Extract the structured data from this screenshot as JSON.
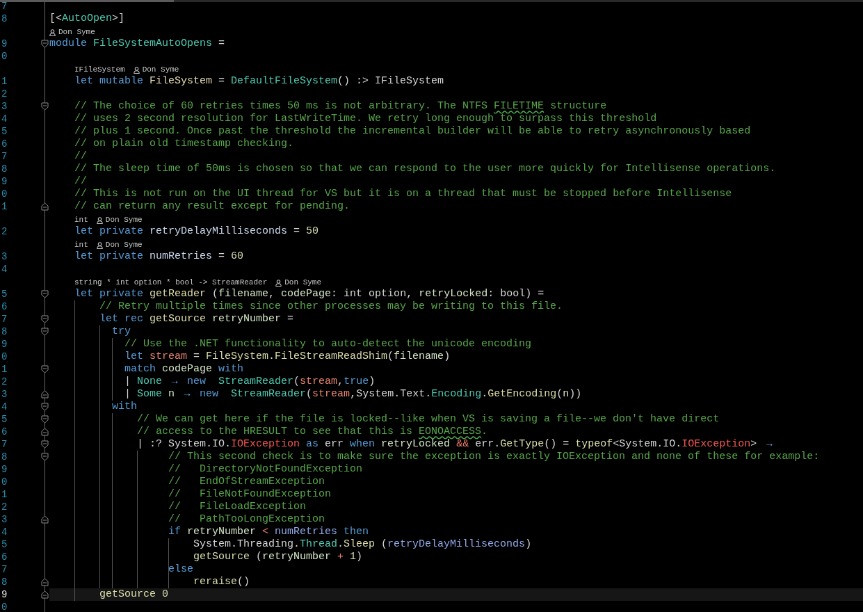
{
  "editor": {
    "rows": [
      {
        "kind": "code",
        "number": "7",
        "fold_start": false,
        "fold_end": false,
        "current": false
      },
      {
        "kind": "code",
        "number": "8",
        "fold_start": false,
        "fold_end": false,
        "current": false,
        "tokens": [
          {
            "kind": "p",
            "text": "[<"
          },
          {
            "kind": "type",
            "text": "AutoOpen"
          },
          {
            "kind": "p",
            "text": ">]"
          }
        ]
      },
      {
        "kind": "lens",
        "items": [
          {
            "kind": "author",
            "text": "Don Syme"
          }
        ]
      },
      {
        "kind": "code",
        "number": "9",
        "fold_start": true,
        "fold_end": false,
        "current": false,
        "tokens": [
          {
            "kind": "kw",
            "text": "module "
          },
          {
            "kind": "type",
            "text": "FileSystemAutoOpens"
          },
          {
            "kind": "p",
            "text": " ="
          }
        ]
      },
      {
        "kind": "code",
        "number": "0",
        "fold_start": false,
        "fold_end": false,
        "current": false
      },
      {
        "kind": "lens",
        "items": [
          {
            "kind": "type",
            "text": "IFileSystem"
          },
          {
            "kind": "author",
            "text": "Don Syme"
          }
        ]
      },
      {
        "kind": "code",
        "number": "1",
        "fold_start": false,
        "fold_end": false,
        "current": false,
        "tokens": [
          {
            "kind": "kw",
            "text": "    let mutable "
          },
          {
            "kind": "var",
            "text": "FileSystem"
          },
          {
            "kind": "p",
            "text": " = "
          },
          {
            "kind": "type",
            "text": "DefaultFileSystem"
          },
          {
            "kind": "p",
            "text": "() :> IFileSystem"
          }
        ]
      },
      {
        "kind": "code",
        "number": "2",
        "fold_start": false,
        "fold_end": false,
        "current": false
      },
      {
        "kind": "code",
        "number": "3",
        "fold_start": true,
        "fold_end": false,
        "current": false,
        "tokens": [
          {
            "kind": "c",
            "text": "    // The choice of 60 retries times 50 ms is not arbitrary. The NTFS "
          },
          {
            "kind": "spell",
            "text": "FILETIME"
          },
          {
            "kind": "c",
            "text": " structure"
          }
        ]
      },
      {
        "kind": "code",
        "number": "4",
        "fold_start": false,
        "fold_end": false,
        "current": false,
        "tokens": [
          {
            "kind": "c",
            "text": "    // uses 2 second resolution for LastWriteTime. We retry long enough to surpass this threshold"
          }
        ]
      },
      {
        "kind": "code",
        "number": "5",
        "fold_start": false,
        "fold_end": false,
        "current": false,
        "tokens": [
          {
            "kind": "c",
            "text": "    // plus 1 second. Once past the threshold the incremental builder will be able to retry asynchronously based"
          }
        ]
      },
      {
        "kind": "code",
        "number": "6",
        "fold_start": false,
        "fold_end": false,
        "current": false,
        "tokens": [
          {
            "kind": "c",
            "text": "    // on plain old timestamp checking."
          }
        ]
      },
      {
        "kind": "code",
        "number": "7",
        "fold_start": false,
        "fold_end": false,
        "current": false,
        "tokens": [
          {
            "kind": "c",
            "text": "    //"
          }
        ]
      },
      {
        "kind": "code",
        "number": "8",
        "fold_start": false,
        "fold_end": false,
        "current": false,
        "tokens": [
          {
            "kind": "c",
            "text": "    // The sleep time of 50ms is chosen so that we can respond to the user more quickly for Intellisense operations."
          }
        ]
      },
      {
        "kind": "code",
        "number": "9",
        "fold_start": false,
        "fold_end": false,
        "current": false,
        "tokens": [
          {
            "kind": "c",
            "text": "    //"
          }
        ]
      },
      {
        "kind": "code",
        "number": "0",
        "fold_start": false,
        "fold_end": false,
        "current": false,
        "tokens": [
          {
            "kind": "c",
            "text": "    // This is not run on the UI thread for VS but it is on a thread that must be stopped before Intellisense"
          }
        ]
      },
      {
        "kind": "code",
        "number": "1",
        "fold_start": false,
        "fold_end": true,
        "current": false,
        "tokens": [
          {
            "kind": "c",
            "text": "    // can return any result except for pending."
          }
        ]
      },
      {
        "kind": "lens",
        "items": [
          {
            "kind": "type",
            "text": "int"
          },
          {
            "kind": "author",
            "text": "Don Syme"
          }
        ]
      },
      {
        "kind": "code",
        "number": "2",
        "fold_start": false,
        "fold_end": false,
        "current": false,
        "tokens": [
          {
            "kind": "kw",
            "text": "    let private "
          },
          {
            "kind": "def",
            "text": "retryDelayMilliseconds"
          },
          {
            "kind": "p",
            "text": " = "
          },
          {
            "kind": "num",
            "text": "50"
          }
        ]
      },
      {
        "kind": "lens",
        "items": [
          {
            "kind": "type",
            "text": "int"
          },
          {
            "kind": "author",
            "text": "Don Syme"
          }
        ]
      },
      {
        "kind": "code",
        "number": "3",
        "fold_start": false,
        "fold_end": false,
        "current": false,
        "tokens": [
          {
            "kind": "kw",
            "text": "    let private "
          },
          {
            "kind": "def",
            "text": "numRetries"
          },
          {
            "kind": "p",
            "text": " = "
          },
          {
            "kind": "num",
            "text": "60"
          }
        ]
      },
      {
        "kind": "code",
        "number": "4",
        "fold_start": false,
        "fold_end": false,
        "current": false
      },
      {
        "kind": "lens",
        "items": [
          {
            "kind": "type",
            "text": "string * int option * bool -> StreamReader"
          },
          {
            "kind": "author",
            "text": "Don Syme"
          }
        ]
      },
      {
        "kind": "code",
        "number": "5",
        "fold_start": true,
        "fold_end": false,
        "current": false,
        "tokens": [
          {
            "kind": "kw",
            "text": "    let private "
          },
          {
            "kind": "fn",
            "text": "getReader"
          },
          {
            "kind": "p",
            "text": " ("
          },
          {
            "kind": "param",
            "text": "filename"
          },
          {
            "kind": "p",
            "text": ", "
          },
          {
            "kind": "param",
            "text": "codePage"
          },
          {
            "kind": "p",
            "text": ": int option, "
          },
          {
            "kind": "param",
            "text": "retryLocked"
          },
          {
            "kind": "p",
            "text": ": bool) ="
          }
        ]
      },
      {
        "kind": "code",
        "number": "6",
        "fold_start": false,
        "fold_end": false,
        "current": false,
        "tokens": [
          {
            "kind": "c",
            "text": "        // Retry multiple times since other processes may be writing to this file."
          }
        ]
      },
      {
        "kind": "code",
        "number": "7",
        "fold_start": true,
        "fold_end": false,
        "current": false,
        "tokens": [
          {
            "kind": "kw",
            "text": "        let rec "
          },
          {
            "kind": "fn",
            "text": "getSource"
          },
          {
            "kind": "param",
            "text": " retryNumber"
          },
          {
            "kind": "p",
            "text": " ="
          }
        ]
      },
      {
        "kind": "code",
        "number": "8",
        "fold_start": true,
        "fold_end": false,
        "current": false,
        "tokens": [
          {
            "kind": "kw",
            "text": "          try"
          }
        ]
      },
      {
        "kind": "code",
        "number": "9",
        "fold_start": false,
        "fold_end": false,
        "current": false,
        "tokens": [
          {
            "kind": "c",
            "text": "            // Use the .NET functionality to auto-detect the unicode encoding"
          }
        ]
      },
      {
        "kind": "code",
        "number": "0",
        "fold_start": false,
        "fold_end": false,
        "current": false,
        "tokens": [
          {
            "kind": "kw",
            "text": "            let "
          },
          {
            "kind": "local",
            "text": "stream"
          },
          {
            "kind": "p",
            "text": " = "
          },
          {
            "kind": "fn",
            "text": "FileSystem.FileStreamReadShim"
          },
          {
            "kind": "p",
            "text": "("
          },
          {
            "kind": "param",
            "text": "filename"
          },
          {
            "kind": "p",
            "text": ")"
          }
        ]
      },
      {
        "kind": "code",
        "number": "1",
        "fold_start": true,
        "fold_end": false,
        "current": false,
        "tokens": [
          {
            "kind": "kw",
            "text": "            match "
          },
          {
            "kind": "param",
            "text": "codePage"
          },
          {
            "kind": "kw",
            "text": " with"
          }
        ]
      },
      {
        "kind": "code",
        "number": "2",
        "fold_start": false,
        "fold_end": false,
        "current": false,
        "tokens": [
          {
            "kind": "p",
            "text": "            | "
          },
          {
            "kind": "type",
            "text": "None "
          },
          {
            "kind": "arrow",
            "text": "→"
          },
          {
            "kind": "kw",
            "text": " new  "
          },
          {
            "kind": "type",
            "text": "StreamReader"
          },
          {
            "kind": "p",
            "text": "("
          },
          {
            "kind": "local",
            "text": "stream"
          },
          {
            "kind": "p",
            "text": ","
          },
          {
            "kind": "kw",
            "text": "true"
          },
          {
            "kind": "p",
            "text": ")"
          }
        ]
      },
      {
        "kind": "code",
        "number": "3",
        "fold_start": false,
        "fold_end": true,
        "current": false,
        "tokens": [
          {
            "kind": "p",
            "text": "            | "
          },
          {
            "kind": "type",
            "text": "Some "
          },
          {
            "kind": "param",
            "text": "n "
          },
          {
            "kind": "arrow",
            "text": "→"
          },
          {
            "kind": "kw",
            "text": " new  "
          },
          {
            "kind": "type",
            "text": "StreamReader"
          },
          {
            "kind": "p",
            "text": "("
          },
          {
            "kind": "local",
            "text": "stream"
          },
          {
            "kind": "p",
            "text": ",System.Text."
          },
          {
            "kind": "type",
            "text": "Encoding"
          },
          {
            "kind": "p",
            "text": "."
          },
          {
            "kind": "fn",
            "text": "GetEncoding"
          },
          {
            "kind": "p",
            "text": "("
          },
          {
            "kind": "param",
            "text": "n"
          },
          {
            "kind": "p",
            "text": "))"
          }
        ]
      },
      {
        "kind": "code",
        "number": "4",
        "fold_start": true,
        "fold_end": false,
        "current": false,
        "tokens": [
          {
            "kind": "kw",
            "text": "          with"
          }
        ]
      },
      {
        "kind": "code",
        "number": "5",
        "fold_start": true,
        "fold_end": false,
        "current": false,
        "tokens": [
          {
            "kind": "c",
            "text": "              // We can get here if the file is locked--like when VS is saving a file--we don't have direct"
          }
        ]
      },
      {
        "kind": "code",
        "number": "6",
        "fold_start": false,
        "fold_end": true,
        "current": false,
        "tokens": [
          {
            "kind": "c",
            "text": "              // access to the HRESULT to see that this is "
          },
          {
            "kind": "spell",
            "text": "EONOACCESS"
          },
          {
            "kind": "c",
            "text": "."
          }
        ]
      },
      {
        "kind": "code",
        "number": "7",
        "fold_start": true,
        "fold_end": false,
        "current": false,
        "tokens": [
          {
            "kind": "p",
            "text": "              | :? System.IO."
          },
          {
            "kind": "err",
            "text": "IOException"
          },
          {
            "kind": "kw",
            "text": " as "
          },
          {
            "kind": "p",
            "text": "err"
          },
          {
            "kind": "kw",
            "text": " when "
          },
          {
            "kind": "param",
            "text": "retryLocked "
          },
          {
            "kind": "op",
            "text": "&&"
          },
          {
            "kind": "p",
            "text": " err."
          },
          {
            "kind": "fn",
            "text": "GetType"
          },
          {
            "kind": "p",
            "text": "() = "
          },
          {
            "kind": "fn",
            "text": "typeof"
          },
          {
            "kind": "p",
            "text": "<System.IO."
          },
          {
            "kind": "err",
            "text": "IOException"
          },
          {
            "kind": "p",
            "text": "> "
          },
          {
            "kind": "arrow",
            "text": "→"
          }
        ]
      },
      {
        "kind": "code",
        "number": "8",
        "fold_start": true,
        "fold_end": false,
        "current": false,
        "tokens": [
          {
            "kind": "c",
            "text": "                   // This second check is to make sure the exception is exactly IOException and none of these for example:"
          }
        ]
      },
      {
        "kind": "code",
        "number": "9",
        "fold_start": false,
        "fold_end": false,
        "current": false,
        "tokens": [
          {
            "kind": "c",
            "text": "                   //   DirectoryNotFoundException"
          }
        ]
      },
      {
        "kind": "code",
        "number": "0",
        "fold_start": false,
        "fold_end": false,
        "current": false,
        "tokens": [
          {
            "kind": "c",
            "text": "                   //   EndOfStreamException"
          }
        ]
      },
      {
        "kind": "code",
        "number": "1",
        "fold_start": false,
        "fold_end": false,
        "current": false,
        "tokens": [
          {
            "kind": "c",
            "text": "                   //   FileNotFoundException"
          }
        ]
      },
      {
        "kind": "code",
        "number": "2",
        "fold_start": false,
        "fold_end": false,
        "current": false,
        "tokens": [
          {
            "kind": "c",
            "text": "                   //   FileLoadException"
          }
        ]
      },
      {
        "kind": "code",
        "number": "3",
        "fold_start": false,
        "fold_end": true,
        "current": false,
        "tokens": [
          {
            "kind": "c",
            "text": "                   //   PathTooLongException"
          }
        ]
      },
      {
        "kind": "code",
        "number": "4",
        "fold_start": false,
        "fold_end": false,
        "current": false,
        "tokens": [
          {
            "kind": "kw",
            "text": "                   if "
          },
          {
            "kind": "param",
            "text": "retryNumber "
          },
          {
            "kind": "op",
            "text": "<"
          },
          {
            "kind": "ref",
            "text": " numRetries"
          },
          {
            "kind": "kw",
            "text": " then"
          }
        ]
      },
      {
        "kind": "code",
        "number": "5",
        "fold_start": false,
        "fold_end": false,
        "current": false,
        "tokens": [
          {
            "kind": "p",
            "text": "                       System.Threading."
          },
          {
            "kind": "type",
            "text": "Thread"
          },
          {
            "kind": "p",
            "text": "."
          },
          {
            "kind": "fn",
            "text": "Sleep"
          },
          {
            "kind": "p",
            "text": " ("
          },
          {
            "kind": "ref",
            "text": "retryDelayMilliseconds"
          },
          {
            "kind": "p",
            "text": ")"
          }
        ]
      },
      {
        "kind": "code",
        "number": "6",
        "fold_start": false,
        "fold_end": false,
        "current": false,
        "tokens": [
          {
            "kind": "fn",
            "text": "                       getSource"
          },
          {
            "kind": "p",
            "text": " ("
          },
          {
            "kind": "param",
            "text": "retryNumber "
          },
          {
            "kind": "op",
            "text": "+"
          },
          {
            "kind": "num",
            "text": " 1"
          },
          {
            "kind": "p",
            "text": ")"
          }
        ]
      },
      {
        "kind": "code",
        "number": "7",
        "fold_start": false,
        "fold_end": false,
        "current": false,
        "tokens": [
          {
            "kind": "kw",
            "text": "                   else"
          }
        ]
      },
      {
        "kind": "code",
        "number": "8",
        "fold_start": false,
        "fold_end": true,
        "current": false,
        "tokens": [
          {
            "kind": "fn",
            "text": "                       reraise"
          },
          {
            "kind": "p",
            "text": "()"
          }
        ]
      },
      {
        "kind": "code",
        "number": "9",
        "fold_start": false,
        "fold_end": true,
        "current": true,
        "tokens": [
          {
            "kind": "fn",
            "text": "        getSource"
          },
          {
            "kind": "num",
            "text": " 0"
          }
        ]
      },
      {
        "kind": "code",
        "number": "0",
        "fold_start": false,
        "fold_end": false,
        "current": false
      }
    ]
  }
}
